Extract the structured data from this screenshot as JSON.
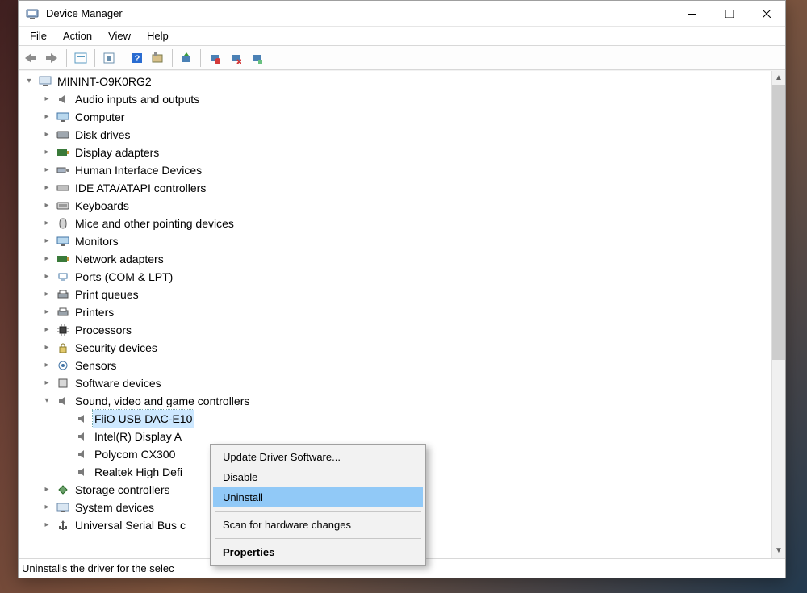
{
  "window": {
    "title": "Device Manager"
  },
  "menu": {
    "file": "File",
    "action": "Action",
    "view": "View",
    "help": "Help"
  },
  "tree": {
    "root": "MININT-O9K0RG2",
    "audio": "Audio inputs and outputs",
    "computer": "Computer",
    "disk": "Disk drives",
    "display": "Display adapters",
    "hid": "Human Interface Devices",
    "ide": "IDE ATA/ATAPI controllers",
    "keyboards": "Keyboards",
    "mice": "Mice and other pointing devices",
    "monitors": "Monitors",
    "network": "Network adapters",
    "ports": "Ports (COM & LPT)",
    "printqueues": "Print queues",
    "printers": "Printers",
    "processors": "Processors",
    "security": "Security devices",
    "sensors": "Sensors",
    "software": "Software devices",
    "sound": "Sound, video and game controllers",
    "sound_children": {
      "fiio": "FiiO USB DAC-E10",
      "intel": "Intel(R) Display A",
      "polycom": "Polycom CX300",
      "realtek": "Realtek High Defi"
    },
    "storage": "Storage controllers",
    "system": "System devices",
    "usb": "Universal Serial Bus c"
  },
  "context_menu": {
    "update": "Update Driver Software...",
    "disable": "Disable",
    "uninstall": "Uninstall",
    "scan": "Scan for hardware changes",
    "properties": "Properties"
  },
  "status": {
    "text": "Uninstalls the driver for the selec"
  }
}
